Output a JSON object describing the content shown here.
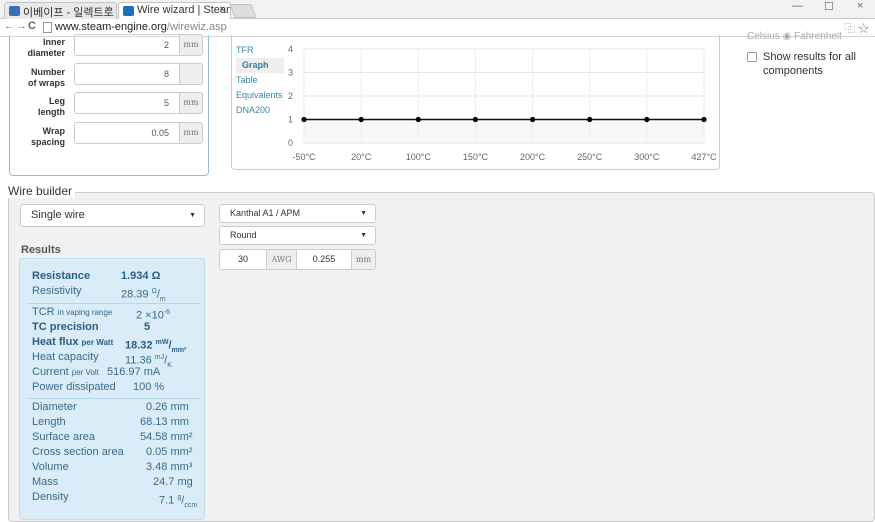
{
  "browser": {
    "tabs": [
      {
        "label": "이베이프 - 일렉트로",
        "icon_color": "#3b6fb6"
      },
      {
        "label": "Wire wizard | Steam",
        "icon_color": "#1d6fb8"
      }
    ],
    "url_host": "www.steam-engine.org",
    "url_path": "/wirewiz.asp",
    "back": "←",
    "forward": "→",
    "reload": "C",
    "close_glyph": "×",
    "translate_icon": "⿻",
    "star_icon": "☆",
    "minimize": "—",
    "maximize": "☐",
    "close": "×"
  },
  "inputs": {
    "rows": [
      {
        "label_line1": "Inner",
        "label_line2": "diameter",
        "value": "2",
        "unit": "mm"
      },
      {
        "label_line1": "Number",
        "label_line2": "of wraps",
        "value": "8",
        "unit": ""
      },
      {
        "label_line1": "Leg",
        "label_line2": "length",
        "value": "5",
        "unit": "mm"
      },
      {
        "label_line1": "Wrap",
        "label_line2": "spacing",
        "value": "0.05",
        "unit": "mm"
      }
    ]
  },
  "graph": {
    "tabs": [
      "TFR",
      "Graph",
      "Table",
      "Equivalents",
      "DNA200"
    ],
    "active_tab": "Graph"
  },
  "chart_data": {
    "type": "line",
    "title": "",
    "xlabel": "",
    "ylabel": "",
    "x": [
      "-50°C",
      "20°C",
      "100°C",
      "150°C",
      "200°C",
      "250°C",
      "300°C",
      "427°C"
    ],
    "series": [
      {
        "values": [
          1,
          1,
          1,
          1,
          1,
          1,
          1,
          1
        ]
      }
    ],
    "yticks": [
      "0",
      "1",
      "2",
      "3",
      "4"
    ],
    "ylim": [
      0,
      4
    ],
    "grid": true
  },
  "options": {
    "show_results_label": "Show results for all components",
    "cutoff_text": "Celsius ◉ Fahrenheit"
  },
  "builder": {
    "legend": "Wire builder",
    "wire_type": "Single wire",
    "material": "Kanthal A1 / APM",
    "shape": "Round",
    "gauge": "30",
    "gauge_unit": "AWG",
    "diameter": "0.255",
    "diameter_unit": "mm",
    "results_heading": "Results"
  },
  "results": {
    "resistance": {
      "label": "Resistance",
      "value": "1.934 Ω"
    },
    "resistivity": {
      "label": "Resistivity",
      "value": "28.39",
      "unit_sup": "Ω",
      "unit_sub": "m"
    },
    "tcr": {
      "label": "TCR",
      "label_small": "in vaping range",
      "value": "2 ×10",
      "exp": "-6"
    },
    "tc_precision": {
      "label": "TC precision",
      "value": "5"
    },
    "heat_flux": {
      "label": "Heat flux",
      "label_small": "per Watt",
      "value": "18.32",
      "unit_sup": "mW",
      "unit_sub": "mm²"
    },
    "heat_capacity": {
      "label": "Heat capacity",
      "value": "11.36",
      "unit_sup": "mJ",
      "unit_sub": "K"
    },
    "current": {
      "label": "Current",
      "label_small": "per Volt",
      "value": "516.97 mA"
    },
    "power": {
      "label": "Power dissipated",
      "value": "100 %"
    },
    "diameter": {
      "label": "Diameter",
      "value": "0.26 mm"
    },
    "length": {
      "label": "Length",
      "value": "68.13 mm"
    },
    "surface_area": {
      "label": "Surface area",
      "value": "54.58 mm²"
    },
    "cross_section": {
      "label": "Cross section area",
      "value": "0.05 mm²"
    },
    "volume": {
      "label": "Volume",
      "value": "3.48 mm³"
    },
    "mass": {
      "label": "Mass",
      "value": "24.7 mg"
    },
    "density": {
      "label": "Density",
      "value": "7.1",
      "unit_sup": "g",
      "unit_sub": "ccm"
    }
  }
}
